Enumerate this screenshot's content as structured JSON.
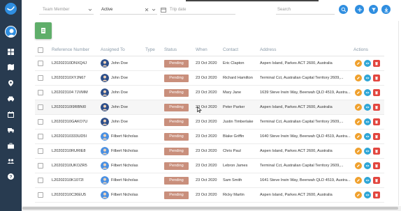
{
  "filters": {
    "team_member_placeholder": "Team Member",
    "status_value": "Active",
    "trip_date_placeholder": "Trip date",
    "search_placeholder": "Search"
  },
  "table": {
    "headers": {
      "reference": "Reference Number",
      "assigned": "Assigned To",
      "type": "Type",
      "status": "Status",
      "when": "When",
      "contact": "Contact",
      "address": "Address",
      "actions": "Actions"
    },
    "rows": [
      {
        "ref": "L20202310DNXQ4J",
        "assigned": "John Doe",
        "type": "",
        "status": "Pending",
        "when": "23 Oct 2020",
        "contact": "Eric Clapton",
        "address": "Aspen Island, Parkes ACT 2600, Australia"
      },
      {
        "ref": "L20202310XYJN67",
        "assigned": "John Doe",
        "type": "",
        "status": "Pending",
        "when": "23 Oct 2020",
        "contact": "Richard Hamilton",
        "address": "Terminal Cct, Australian Capital Territory 2609,..."
      },
      {
        "ref": "L202023104 7JVMM",
        "assigned": "John Doe",
        "type": "",
        "status": "Pending",
        "when": "23 Oct 2020",
        "contact": "Mary Jane",
        "address": "1639 Steve Irwin Way, Beerwah QLD 4519, Austra..."
      },
      {
        "ref": "L20202310I9RBNI0",
        "assigned": "John Doe",
        "type": "",
        "status": "Pending",
        "when": "23 Oct 2020",
        "contact": "Peter Parker",
        "address": "Aspen Island, Parkes ACT 2600, Australia"
      },
      {
        "ref": "L20202310GAKO7U",
        "assigned": "John Doe",
        "type": "",
        "status": "Pending",
        "when": "23 Oct 2020",
        "contact": "Justin Timberlake",
        "address": "Terminal Cct, Australian Capital Territory 2609,..."
      },
      {
        "ref": "L20202310333UD5I",
        "assigned": "Filbert Nicholas",
        "type": "",
        "status": "Pending",
        "when": "23 Oct 2020",
        "contact": "Blake Griffin",
        "address": "1640 Steve Irwin Way, Beerwah QLD 4519, Austra..."
      },
      {
        "ref": "L20202310RURIE8",
        "assigned": "Filbert Nicholas",
        "type": "",
        "status": "Pending",
        "when": "23 Oct 2020",
        "contact": "Chris Paul",
        "address": "Aspen Island, Parkes ACT 2600, Australia"
      },
      {
        "ref": "L20202310UKOZR5",
        "assigned": "Filbert Nicholas",
        "type": "",
        "status": "Pending",
        "when": "23 Oct 2020",
        "contact": "Lebron James",
        "address": "Terminal Cct, Australian Capital Territory 2609,..."
      },
      {
        "ref": "L20202310K1072I",
        "assigned": "Filbert Nicholas",
        "type": "",
        "status": "Pending",
        "when": "23 Oct 2020",
        "contact": "Sam Smith",
        "address": "1641 Steve Irwin Way, Beerwah QLD 4519, Austra..."
      },
      {
        "ref": "L20202310C36EU5",
        "assigned": "Filbert Nicholas",
        "type": "",
        "status": "Pending",
        "when": "23 Oct 2020",
        "contact": "Ricky Martin",
        "address": "Aspen Island, Parkes ACT 2600, Australia"
      }
    ]
  },
  "colors": {
    "sidebar": "#283b50",
    "primary": "#2f8ee0",
    "status_pending": "#c98f7c",
    "add_card": "#5fae6a",
    "edit": "#f0a12e",
    "view": "#2fa6d6",
    "delete": "#e2463f"
  },
  "icons": {
    "sidebar": [
      "dashboard-icon",
      "map-icon",
      "location-icon",
      "car-icon",
      "calendar-icon",
      "truck-icon",
      "briefcase-icon",
      "team-icon",
      "help-icon"
    ],
    "toolbar": [
      "search-icon",
      "add-icon",
      "filter-icon",
      "download-icon"
    ]
  }
}
